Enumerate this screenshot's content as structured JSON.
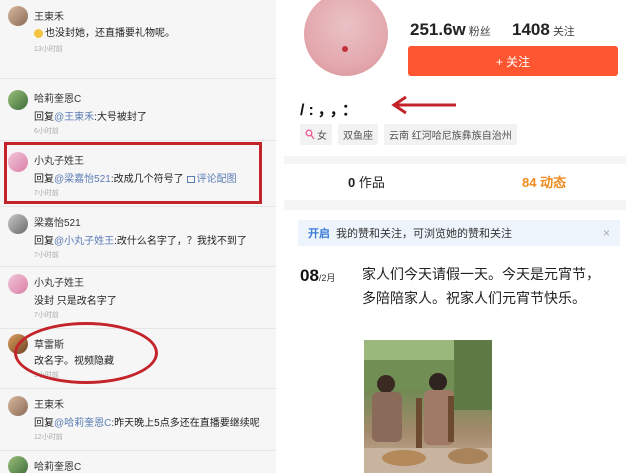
{
  "comments": [
    {
      "name": "王東禾",
      "text": "也没封她，还直播要礼物呢。",
      "time": "13小时前"
    },
    {
      "name": "哈莉奎恩C",
      "reply_prefix": "回复",
      "mention": "@王東禾",
      "text": ":大号被封了",
      "time": "6小时前"
    },
    {
      "name": "小丸子姓王",
      "reply_prefix": "回复",
      "mention": "@梁嘉怡521",
      "text": ":改成几个符号了",
      "link": "评论配图",
      "time": "7小时前"
    },
    {
      "name": "梁嘉怡521",
      "reply_prefix": "回复",
      "mention": "@小丸子姓王",
      "text": ":改什么名字了，？我找不到了",
      "time": "7小时前"
    },
    {
      "name": "小丸子姓王",
      "text": "没封 只是改名字了",
      "time": "7小时前"
    },
    {
      "name": "草雷斯",
      "text": "改名字。视频隐藏",
      "time": "5小时前"
    },
    {
      "name": "王東禾",
      "reply_prefix": "回复",
      "mention": "@哈莉奎恩C",
      "text": ":昨天晚上5点多还在直播要继续呢",
      "time": "12小时前"
    },
    {
      "name": "哈莉奎恩C",
      "text": "",
      "time": ""
    }
  ],
  "profile": {
    "fans_count": "251.6w",
    "fans_label": "粉丝",
    "following_count": "1408",
    "following_label": "关注",
    "follow_button": "+ 关注",
    "nickname": "/:，，：",
    "tags": [
      "女",
      "双鱼座",
      "云南 红河哈尼族彝族自治州"
    ],
    "works_count": "0",
    "works_label": "作品",
    "dynamic_count": "84",
    "dynamic_label": "动态",
    "banner_open": "开启",
    "banner_text": "我的赞和关注，可浏览她的赞和关注",
    "banner_close": "×",
    "post_day": "08",
    "post_month": "/2月",
    "post_text": "家人们今天请假一天。今天是元宵节，多陪陪家人。祝家人们元宵节快乐。"
  },
  "colors": {
    "accent": "#fe5630",
    "annotation_red": "#c3242a",
    "mention_blue": "#5a7cb5",
    "banner_blue": "#3d7bd8"
  },
  "icons": [
    "smile-icon",
    "image-icon",
    "female-icon",
    "arrow-left-icon",
    "close-icon"
  ]
}
